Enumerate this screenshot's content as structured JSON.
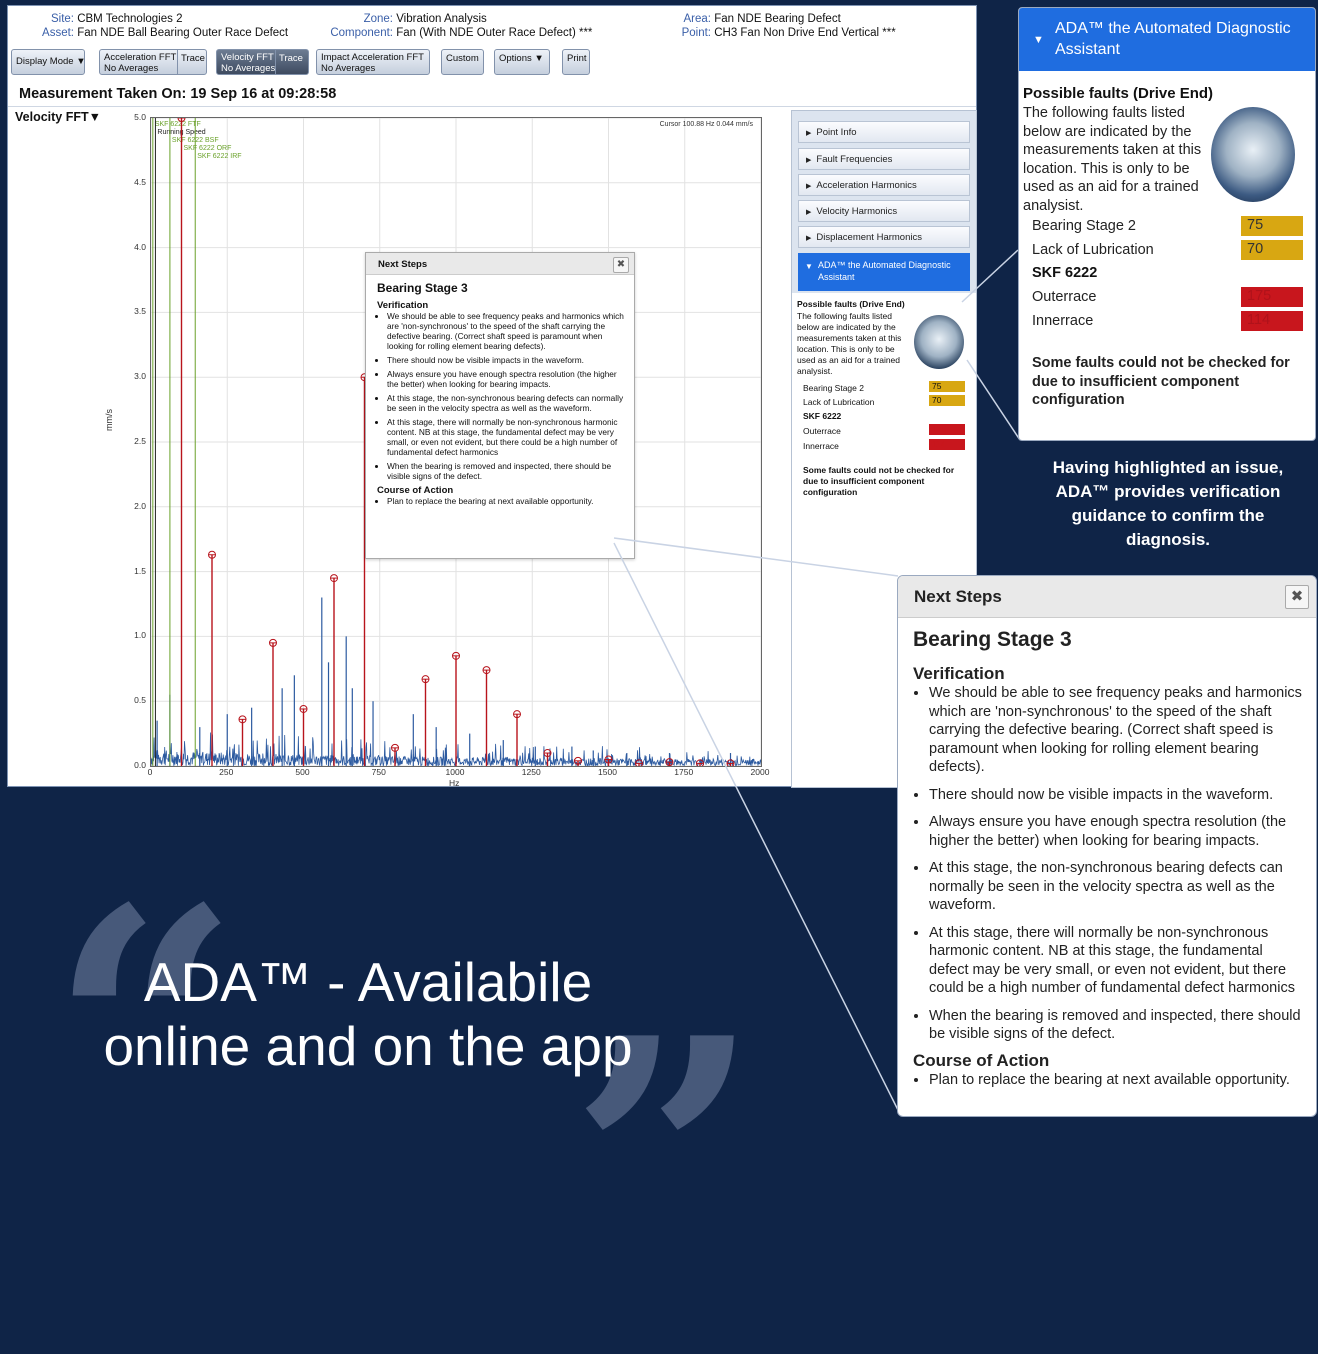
{
  "header": {
    "site_label": "Site:",
    "site": "CBM Technologies 2",
    "asset_label": "Asset:",
    "asset": "Fan NDE Ball Bearing Outer Race Defect",
    "zone_label": "Zone:",
    "zone": "Vibration Analysis",
    "component_label": "Component:",
    "component": "Fan (With NDE Outer Race Defect) ***",
    "area_label": "Area:",
    "area": "Fan NDE Bearing Defect",
    "point_label": "Point:",
    "point": "CH3 Fan Non Drive End Vertical ***"
  },
  "toolbar": {
    "display_mode": "Display Mode ▼",
    "accel_fft_1": "Acceleration FFT",
    "accel_fft_2": "No Averages",
    "accel_trace": "Trace",
    "vel_fft_1": "Velocity FFT",
    "vel_fft_2": "No Averages",
    "vel_trace": "Trace",
    "impact_1": "Impact Acceleration FFT",
    "impact_2": "No Averages",
    "custom": "Custom",
    "options": "Options ▼",
    "print": "Print"
  },
  "measurement": "Measurement Taken On: 19 Sep 16 at 09:28:58",
  "chart_selector": "Velocity FFT▼",
  "cursor_readout": "Cursor    100.88 Hz 0.044 mm/s",
  "chart_data": {
    "type": "line",
    "title": "",
    "xlabel": "Hz",
    "ylabel": "mm/s",
    "xlim": [
      0,
      2000
    ],
    "ylim": [
      0,
      5.0
    ],
    "x_ticks": [
      0,
      250,
      500,
      750,
      1000,
      1250,
      1500,
      1750,
      2000
    ],
    "y_ticks": [
      "0.0",
      "0.5",
      "1.0",
      "1.5",
      "2.0",
      "2.5",
      "3.0",
      "3.5",
      "4.0",
      "4.5",
      "5.0"
    ],
    "grid": true,
    "markers": [
      {
        "label": "SKF 6222 FTF",
        "x": 6,
        "color": "#6aa12a"
      },
      {
        "label": "Running Speed",
        "x": 14.5,
        "color": "#222222"
      },
      {
        "label": "SKF 6222 BSF",
        "x": 62,
        "color": "#6aa12a"
      },
      {
        "label": "SKF 6222 ORF",
        "x": 100,
        "color": "#6aa12a"
      },
      {
        "label": "SKF 6222 IRF",
        "x": 145,
        "color": "#6aa12a"
      }
    ],
    "harmonics": [
      {
        "x": 100,
        "y": 5.0
      },
      {
        "x": 200,
        "y": 1.63
      },
      {
        "x": 300,
        "y": 0.36
      },
      {
        "x": 400,
        "y": 0.95
      },
      {
        "x": 500,
        "y": 0.44
      },
      {
        "x": 600,
        "y": 1.45
      },
      {
        "x": 700,
        "y": 3.0
      },
      {
        "x": 800,
        "y": 0.14
      },
      {
        "x": 900,
        "y": 0.67
      },
      {
        "x": 1000,
        "y": 0.85
      },
      {
        "x": 1100,
        "y": 0.74
      },
      {
        "x": 1200,
        "y": 0.4
      },
      {
        "x": 1300,
        "y": 0.1
      },
      {
        "x": 1400,
        "y": 0.04
      },
      {
        "x": 1500,
        "y": 0.05
      },
      {
        "x": 1600,
        "y": 0.02
      },
      {
        "x": 1700,
        "y": 0.03
      },
      {
        "x": 1800,
        "y": 0.02
      },
      {
        "x": 1900,
        "y": 0.02
      }
    ],
    "spectrum_peaks": [
      {
        "x": 20,
        "y": 0.35
      },
      {
        "x": 62,
        "y": 0.55
      },
      {
        "x": 160,
        "y": 0.3
      },
      {
        "x": 250,
        "y": 0.4
      },
      {
        "x": 330,
        "y": 0.45
      },
      {
        "x": 430,
        "y": 0.6
      },
      {
        "x": 470,
        "y": 0.7
      },
      {
        "x": 560,
        "y": 1.3
      },
      {
        "x": 582,
        "y": 0.8
      },
      {
        "x": 640,
        "y": 1.0
      },
      {
        "x": 660,
        "y": 0.6
      },
      {
        "x": 728,
        "y": 0.5
      },
      {
        "x": 860,
        "y": 0.4
      },
      {
        "x": 935,
        "y": 0.3
      },
      {
        "x": 1045,
        "y": 0.25
      },
      {
        "x": 1155,
        "y": 0.2
      },
      {
        "x": 1260,
        "y": 0.15
      },
      {
        "x": 1380,
        "y": 0.15
      },
      {
        "x": 1450,
        "y": 0.12
      },
      {
        "x": 1560,
        "y": 0.1
      },
      {
        "x": 1700,
        "y": 0.1
      },
      {
        "x": 1900,
        "y": 0.1
      }
    ]
  },
  "sidepanel": {
    "items": [
      "Point Info",
      "Fault Frequencies",
      "Acceleration Harmonics",
      "Velocity Harmonics",
      "Displacement Harmonics"
    ],
    "ada_title": "ADA™ the Automated Diagnostic Assistant"
  },
  "ada": {
    "possible_faults": "Possible faults (Drive End)",
    "intro": "The following faults listed below are indicated by the measurements taken at this location. This is only to be used as an aid for a trained analysist.",
    "faults": [
      {
        "name": "Bearing Stage 2",
        "score": "75",
        "color": "#d8a712"
      },
      {
        "name": "Lack of Lubrication",
        "score": "70",
        "color": "#d8a712"
      }
    ],
    "group": "SKF 6222",
    "group_faults": [
      {
        "name": "Outerrace",
        "score": "175",
        "color": "#c8161d"
      },
      {
        "name": "Innerrace",
        "score": "114",
        "color": "#c8161d"
      }
    ],
    "note": "Some faults could not be checked for due to insufficient component configuration"
  },
  "next_steps": {
    "bar_title": "Next Steps",
    "title": "Bearing Stage 3",
    "verification_heading": "Verification",
    "verification": [
      "We should be able to see frequency peaks and harmonics which are 'non-synchronous' to the speed of the shaft carrying the defective bearing. (Correct shaft speed is paramount when looking for rolling element bearing defects).",
      "There should now be visible impacts in the waveform.",
      "Always ensure you have enough spectra resolution (the higher the better) when looking for bearing impacts.",
      "At this stage, the non-synchronous bearing defects can normally be seen in the velocity spectra as well as the waveform.",
      "At this stage, there will normally be non-synchronous harmonic content. NB at this stage, the fundamental defect may be very small, or even not evident, but there could be a high number of fundamental defect harmonics",
      "When the bearing is removed and inspected, there should be visible signs of the defect."
    ],
    "action_heading": "Course of Action",
    "actions": [
      "Plan to replace the bearing at next available opportunity."
    ]
  },
  "caption": "Having highlighted an issue, ADA™ provides verification guidance to confirm the diagnosis.",
  "quote_line1": "ADA™ - Availabile",
  "quote_line2": "online and on the app",
  "quote_open": "“",
  "quote_close": "”"
}
